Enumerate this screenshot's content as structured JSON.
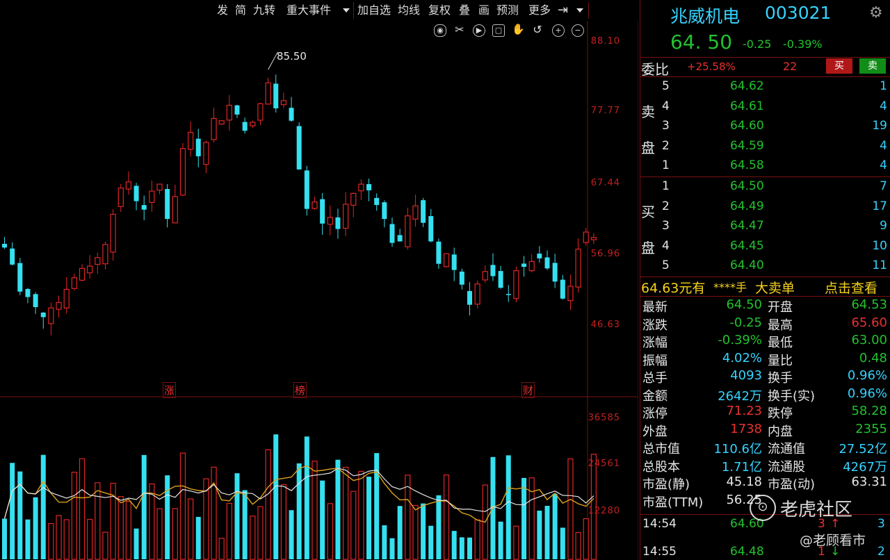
{
  "toolbar": {
    "items": [
      "发",
      "简",
      "九转",
      "重大事件",
      "加自选",
      "均线",
      "复权",
      "叠",
      "画",
      "预测",
      "更多"
    ]
  },
  "tools": {
    "icons": [
      "eye-icon",
      "scissors-icon",
      "play-icon",
      "lock-icon",
      "hand-icon",
      "undo-icon",
      "zoom-in-icon",
      "zoom-out-icon"
    ]
  },
  "chart": {
    "price_axis": [
      "88.10",
      "77.77",
      "67.44",
      "56.96",
      "46.63"
    ],
    "volume_axis": [
      "36585",
      "24561",
      "12280"
    ],
    "high_marker": "85.50",
    "event_markers": [
      "涨",
      "榜",
      "财"
    ],
    "colors": {
      "up": "#e22525",
      "down": "#35e0f0",
      "ma_fast": "#e0a020",
      "ma_slow": "#e6e6e6"
    }
  },
  "chart_data": {
    "type": "candlestick",
    "ohlc_approx_close": [
      63.2,
      61.0,
      57.5,
      56.8,
      55.5,
      54.2,
      55.4,
      56.1,
      57.8,
      59.3,
      60.5,
      60.8,
      61.9,
      63.6,
      67.5,
      70.9,
      71.7,
      69.2,
      68.1,
      70.5,
      71.4,
      66.9,
      69.8,
      76.0,
      78.1,
      75.0,
      76.8,
      79.9,
      79.6,
      81.6,
      80.4,
      78.3,
      79.4,
      81.8,
      84.5,
      81.2,
      82.2,
      79.6,
      73.3,
      68.2,
      69.1,
      66.3,
      67.1,
      65.6,
      68.8,
      70.2,
      71.4,
      70.6,
      68.7,
      66.9,
      63.8,
      64.0,
      67.3,
      68.6,
      66.4,
      64.0,
      61.1,
      62.4,
      60.3,
      58.4,
      55.8,
      58.5,
      60.1,
      59.5,
      58.0,
      57.1,
      60.2,
      60.7,
      61.4,
      61.8,
      60.5,
      58.8,
      56.6,
      58.2,
      63.0,
      65.2,
      64.5
    ],
    "volume_axis_ticks": [
      "36585",
      "24561",
      "12280"
    ],
    "price_axis_ticks": [
      "88.10",
      "77.77",
      "67.44",
      "56.96",
      "46.63"
    ],
    "annotations": [
      "85.50"
    ]
  },
  "panel": {
    "stock_name": "兆威机电",
    "stock_code": "003021",
    "last_price": "64. 50",
    "change": "-0.25",
    "change_pct": "-0.39%",
    "weibi_label": "委比",
    "weibi_value": "+25.58%",
    "weicha_value": "22",
    "buy_button": "买",
    "sell_button": "卖",
    "sell_label_1": "卖",
    "sell_label_2": "盘",
    "buy_label_1": "买",
    "buy_label_2": "盘",
    "asks": [
      {
        "lvl": "5",
        "price": "64.62",
        "vol": "1"
      },
      {
        "lvl": "4",
        "price": "64.61",
        "vol": "4"
      },
      {
        "lvl": "3",
        "price": "64.60",
        "vol": "19"
      },
      {
        "lvl": "2",
        "price": "64.59",
        "vol": "4"
      },
      {
        "lvl": "1",
        "price": "64.58",
        "vol": "4"
      }
    ],
    "bids": [
      {
        "lvl": "1",
        "price": "64.50",
        "vol": "7"
      },
      {
        "lvl": "2",
        "price": "64.49",
        "vol": "17"
      },
      {
        "lvl": "3",
        "price": "64.47",
        "vol": "9"
      },
      {
        "lvl": "4",
        "price": "64.45",
        "vol": "10"
      },
      {
        "lvl": "5",
        "price": "64.40",
        "vol": "11"
      }
    ],
    "big_order_price": "64.63元有",
    "big_order_mask": "****手",
    "big_order_type": "大卖单",
    "big_order_link": "点击查看",
    "stats": [
      {
        "l1": "最新",
        "v1": "64.50",
        "c1": "green",
        "l2": "开盘",
        "v2": "64.53",
        "c2": "green"
      },
      {
        "l1": "涨跌",
        "v1": "-0.25",
        "c1": "green",
        "l2": "最高",
        "v2": "65.60",
        "c2": "red"
      },
      {
        "l1": "涨幅",
        "v1": "-0.39%",
        "c1": "green",
        "l2": "最低",
        "v2": "63.00",
        "c2": "green"
      },
      {
        "l1": "振幅",
        "v1": "4.02%",
        "c1": "cyan",
        "l2": "量比",
        "v2": "0.48",
        "c2": "green"
      },
      {
        "l1": "总手",
        "v1": "4093",
        "c1": "cyan",
        "l2": "换手",
        "v2": "0.96%",
        "c2": "cyan"
      },
      {
        "l1": "金额",
        "v1": "2642万",
        "c1": "cyan",
        "l2": "换手(实)",
        "v2": "0.96%",
        "c2": "cyan"
      },
      {
        "l1": "涨停",
        "v1": "71.23",
        "c1": "red",
        "l2": "跌停",
        "v2": "58.28",
        "c2": "green"
      },
      {
        "l1": "外盘",
        "v1": "1738",
        "c1": "red",
        "l2": "内盘",
        "v2": "2355",
        "c2": "green"
      },
      {
        "l1": "总市值",
        "v1": "110.6亿",
        "c1": "cyan",
        "l2": "流通值",
        "v2": "27.52亿",
        "c2": "cyan"
      },
      {
        "l1": "总股本",
        "v1": "1.71亿",
        "c1": "cyan",
        "l2": "流通股",
        "v2": "4267万",
        "c2": "cyan"
      },
      {
        "l1": "市盈(静)",
        "v1": "45.18",
        "c1": "white",
        "l2": "市盈(动)",
        "v2": "63.31",
        "c2": "white"
      },
      {
        "l1": "市盈(TTM)",
        "v1": "56.25",
        "c1": "white",
        "l2": "",
        "v2": "",
        "c2": "white"
      }
    ],
    "ticks": [
      {
        "time": "14:54",
        "price": "64.60",
        "vol": "3",
        "n": "3"
      },
      {
        "time": "14:55",
        "price": "64.48",
        "vol": "1",
        "n": "2"
      }
    ]
  },
  "watermark": {
    "brand": "老虎社区",
    "author": "@老顾看市"
  }
}
